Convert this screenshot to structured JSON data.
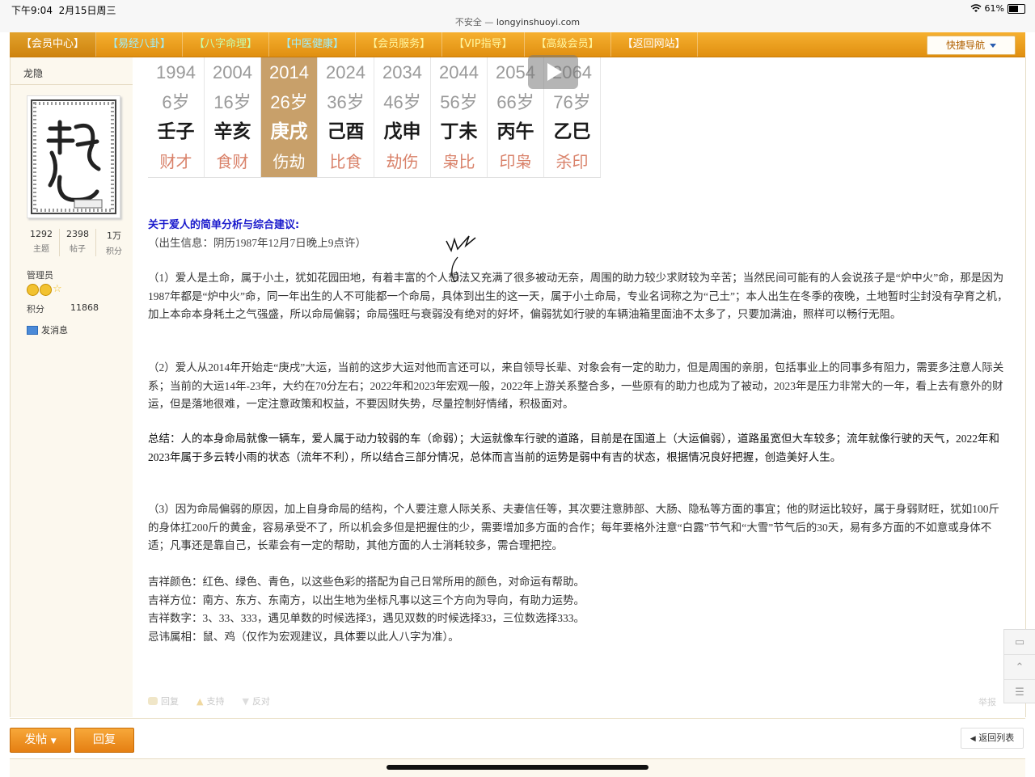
{
  "status_bar": {
    "time": "下午9:04",
    "date": "2月15日周三",
    "url_prefix": "不安全 — ",
    "url": "longyinshuoyi.com",
    "battery": "61%",
    "battery_level": 0.61
  },
  "nav": {
    "items": [
      "【会员中心】",
      "【易经八卦】",
      "【八字命理】",
      "【中医健康】",
      "【会员服务】",
      "【VIP指导】",
      "【高级会员】",
      "【返回网站】"
    ],
    "quick_nav": "快捷导航"
  },
  "user": {
    "name": "龙隐",
    "stats": [
      {
        "value": "1292",
        "label": "主题"
      },
      {
        "value": "2398",
        "label": "帖子"
      },
      {
        "value": "1万",
        "label": "积分"
      }
    ],
    "group": "管理员",
    "credit_label": "积分",
    "credit_value": "11868",
    "send_message": "发消息"
  },
  "dayun": [
    {
      "year": "1994",
      "age": "6岁",
      "ganzhi": "壬子",
      "shishen": "财才",
      "highlight": false
    },
    {
      "year": "2004",
      "age": "16岁",
      "ganzhi": "辛亥",
      "shishen": "食财",
      "highlight": false
    },
    {
      "year": "2014",
      "age": "26岁",
      "ganzhi": "庚戌",
      "shishen": "伤劫",
      "highlight": true
    },
    {
      "year": "2024",
      "age": "36岁",
      "ganzhi": "己酉",
      "shishen": "比食",
      "highlight": false
    },
    {
      "year": "2034",
      "age": "46岁",
      "ganzhi": "戊申",
      "shishen": "劫伤",
      "highlight": false
    },
    {
      "year": "2044",
      "age": "56岁",
      "ganzhi": "丁未",
      "shishen": "枭比",
      "highlight": false
    },
    {
      "year": "2054",
      "age": "66岁",
      "ganzhi": "丙午",
      "shishen": "印枭",
      "highlight": false
    },
    {
      "year": "2064",
      "age": "76岁",
      "ganzhi": "乙巳",
      "shishen": "杀印",
      "highlight": false
    }
  ],
  "post": {
    "title": "关于爱人的简单分析与综合建议:",
    "birth_info": "（出生信息：阴历1987年12月7日晚上9点许）",
    "p1": "（1）爱人是土命，属于小土，犹如花园田地，有着丰富的个人想法又充满了很多被动无奈，周围的助力较少求财较为辛苦；当然民间可能有的人会说孩子是“炉中火”命，那是因为1987年都是“炉中火”命，同一年出生的人不可能都一个命局，具体到出生的这一天，属于小土命局，专业名词称之为“己土”；本人出生在冬季的夜晚，土地暂时尘封没有孕育之机，加上本命本身耗土之气强盛，所以命局偏弱；命局强旺与衰弱没有绝对的好坏，偏弱犹如行驶的车辆油箱里面油不太多了，只要加满油，照样可以畅行无阻。",
    "p2": "（2）爱人从2014年开始走“庚戌”大运，当前的这步大运对他而言还可以，来自领导长辈、对象会有一定的助力，但是周围的亲朋，包括事业上的同事多有阻力，需要多注意人际关系；当前的大运14年-23年，大约在70分左右；2022年和2023年宏观一般，2022年上游关系整合多，一些原有的助力也成为了被动，2023年是压力非常大的一年，看上去有意外的财运，但是落地很难，一定注意政策和权益，不要因财失势，尽量控制好情绪，积极面对。",
    "summary": "总结：人的本身命局就像一辆车，爱人属于动力较弱的车（命弱）；大运就像车行驶的道路，目前是在国道上（大运偏弱），道路虽宽但大车较多；流年就像行驶的天气，2022年和2023年属于多云转小雨的状态（流年不利），所以结合三部分情况，总体而言当前的运势是弱中有吉的状态，根据情况良好把握，创造美好人生。",
    "p3": "（3）因为命局偏弱的原因，加上自身命局的结构，个人要注意人际关系、夫妻信任等，其次要注意肺部、大肠、隐私等方面的事宜；他的财运比较好，属于身弱财旺，犹如100斤的身体扛200斤的黄金，容易承受不了，所以机会多但是把握住的少，需要增加多方面的合作；每年要格外注意“白露”节气和“大雪”节气后的30天，易有多方面的不如意或身体不适；凡事还是靠自己，长辈会有一定的帮助，其他方面的人士消耗较多，需合理把控。",
    "lucky": [
      "吉祥颜色：红色、绿色、青色，以这些色彩的搭配为自己日常所用的颜色，对命运有帮助。",
      "吉祥方位：南方、东方、东南方，以出生地为坐标凡事以这三个方向为导向，有助力运势。",
      "吉祥数字：3、33、333，遇见单数的时候选择3，遇见双数的时候选择33，三位数选择333。",
      "忌讳属相：鼠、鸡（仅作为宏观建议，具体要以此人八字为准）。"
    ]
  },
  "post_actions": {
    "reply": "回复",
    "support": "支持",
    "oppose": "反对",
    "report": "举报"
  },
  "bottom": {
    "post_button": "发帖",
    "reply_button": "回复",
    "back_to_list": "返回列表"
  },
  "colors": {
    "nav_orange": "#e08f10",
    "highlight_col": "#c8a06a",
    "title_blue": "#1a1acc",
    "shishen_red": "#d9826a"
  }
}
